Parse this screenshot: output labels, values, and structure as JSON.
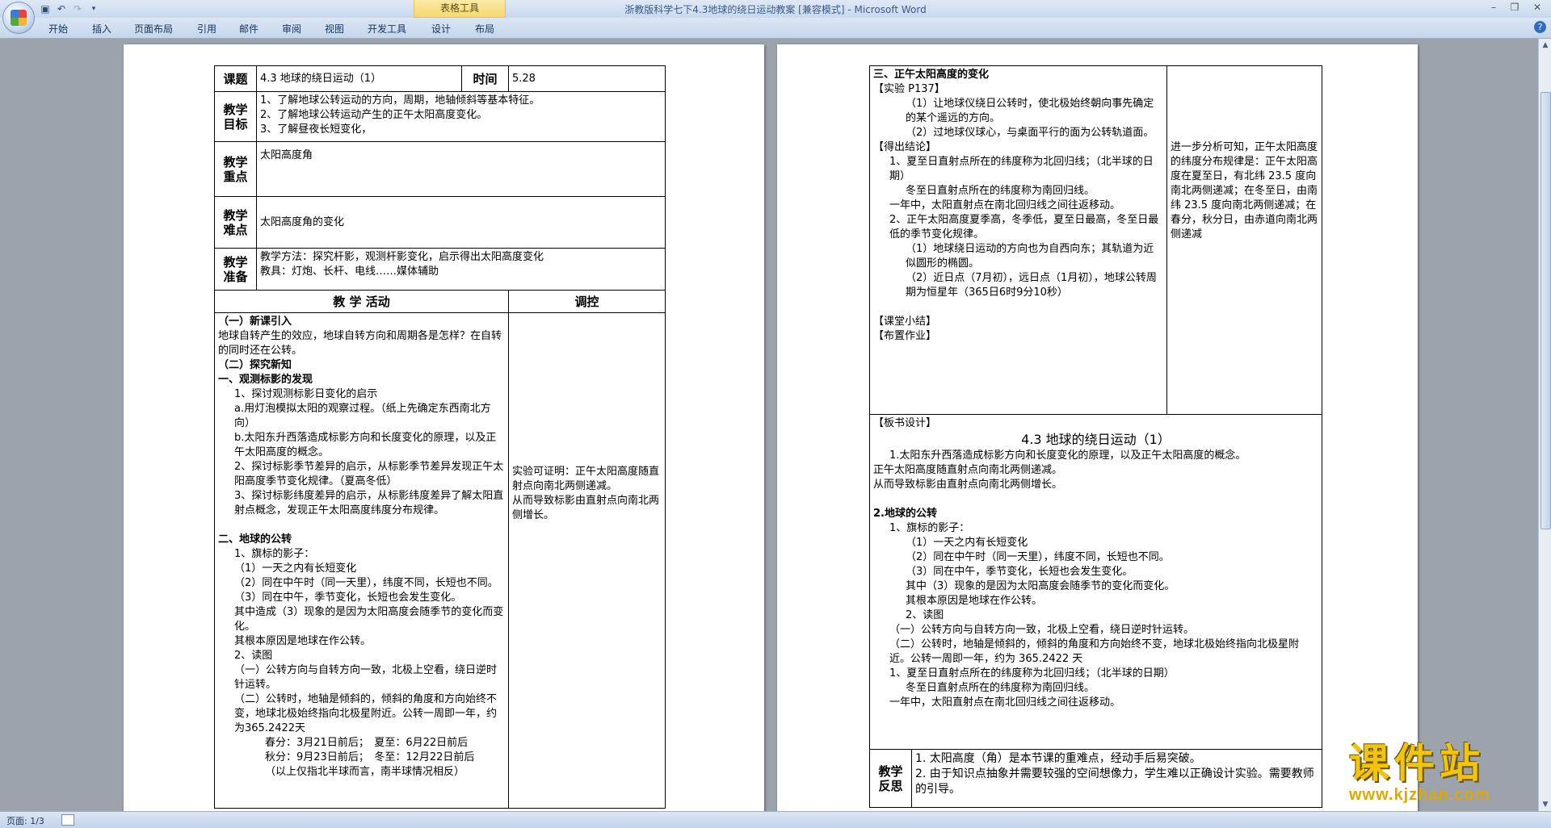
{
  "window": {
    "title": "浙教版科学七下4.3地球的绕日运动教案 [兼容模式] - Microsoft Word",
    "context_tab": "表格工具",
    "controls": [
      "–",
      "❐",
      "✕"
    ]
  },
  "quick_access": {
    "icons": [
      "save-icon",
      "undo-icon",
      "redo-icon",
      "customize-icon"
    ]
  },
  "ribbon": {
    "tabs": [
      "开始",
      "插入",
      "页面布局",
      "引用",
      "邮件",
      "审阅",
      "视图",
      "开发工具",
      "设计",
      "布局"
    ],
    "help": "?"
  },
  "page1": {
    "topic_label": "课题",
    "topic_value": "4.3 地球的绕日运动（1）",
    "time_label": "时间",
    "time_value": "5.28",
    "goal_label": "教学目标",
    "goals": [
      "1、了解地球公转运动的方向，周期，地轴倾斜等基本特征。",
      "2、了解地球公转运动产生的正午太阳高度变化。",
      "3、了解昼夜长短变化，"
    ],
    "focus_label": "教学重点",
    "focus_value": "太阳高度角",
    "difficulty_label": "教学难点",
    "difficulty_value": "太阳高度角的变化",
    "prep_label": "教学准备",
    "prep_lines": [
      "教学方法：探究杆影，观测杆影变化，启示得出太阳高度变化",
      "教具：灯炮、长杆、电线……媒体辅助"
    ],
    "activity_header": "教 学 活动",
    "control_header": "调控",
    "activity_lines": [
      {
        "t": "（一）新课引入",
        "c": "bold"
      },
      {
        "t": "地球自转产生的效应，地球自转方向和周期各是怎样？在自转的同时还在公转。",
        "c": ""
      },
      {
        "t": "（二）探究新知",
        "c": "bold"
      },
      {
        "t": "一、观测标影的发现",
        "c": "bold"
      },
      {
        "t": "1、探讨观测标影日变化的启示",
        "c": "ind1"
      },
      {
        "t": "a.用灯泡模拟太阳的观察过程。（纸上先确定东西南北方向）",
        "c": "ind1"
      },
      {
        "t": "b.太阳东升西落造成标影方向和长度变化的原理，以及正午太阳高度的概念。",
        "c": "ind1"
      },
      {
        "t": "2、探讨标影季节差异的启示，从标影季节差异发现正午太阳高度季节变化规律。（夏高冬低）",
        "c": "ind1"
      },
      {
        "t": "3、探讨标影纬度差异的启示，从标影纬度差异了解太阳直射点概念，发现正午太阳高度纬度分布规律。",
        "c": "ind1"
      },
      {
        "t": "",
        "c": ""
      },
      {
        "t": "二、地球的公转",
        "c": "bold"
      },
      {
        "t": "1、旗标的影子：",
        "c": "ind1"
      },
      {
        "t": "（1）一天之内有长短变化",
        "c": "ind1"
      },
      {
        "t": "（2）同在中午时（同一天里），纬度不同，长短也不同。",
        "c": "ind1"
      },
      {
        "t": "（3）同在中午，季节变化，长短也会发生变化。",
        "c": "ind1"
      },
      {
        "t": "其中造成（3）现象的是因为太阳高度会随季节的变化而变化。",
        "c": "ind1"
      },
      {
        "t": "其根本原因是地球在作公转。",
        "c": "ind1"
      },
      {
        "t": "2、读图",
        "c": "ind1"
      },
      {
        "t": "（一）公转方向与自转方向一致，北极上空看，绕日逆时针运转。",
        "c": "ind1"
      },
      {
        "t": "（二）公转时，地轴是倾斜的，倾斜的角度和方向始终不变，地球北极始终指向北极星附近。公转一周即一年，约为365.2422天",
        "c": "ind1"
      },
      {
        "t": "春分：3月21日前后；　夏至：6月22日前后",
        "c": "ind3"
      },
      {
        "t": "秋分：9月23日前后；　冬至：12月22日前后",
        "c": "ind3"
      },
      {
        "t": "（以上仅指北半球而言，南半球情况相反）",
        "c": "ind3"
      }
    ],
    "control_note_1": "实验可证明：正午太阳高度随直射点向南北两侧递减。",
    "control_note_2": "从而导致标影由直射点向南北两侧增长。"
  },
  "page2": {
    "left_lines": [
      {
        "t": "三、正午太阳高度的变化",
        "c": "bold"
      },
      {
        "t": "【实验 P137】",
        "c": ""
      },
      {
        "t": "（1）让地球仪绕日公转时，使北极始终朝向事先确定的某个遥远的方向。",
        "c": "ind2"
      },
      {
        "t": "（2）过地球仪球心，与桌面平行的面为公转轨道面。",
        "c": "ind2"
      },
      {
        "t": "【得出结论】",
        "c": ""
      },
      {
        "t": "1、夏至日直射点所在的纬度称为北回归线；（北半球的日期）",
        "c": "ind1"
      },
      {
        "t": "冬至日直射点所在的纬度称为南回归线。",
        "c": "ind2"
      },
      {
        "t": "一年中，太阳直射点在南北回归线之间往返移动。",
        "c": "ind1"
      },
      {
        "t": "2、正午太阳高度夏季高，冬季低，夏至日最高，冬至日最低的季节变化规律。",
        "c": "ind1"
      },
      {
        "t": "（1）地球绕日运动的方向也为自西向东；其轨道为近似圆形的椭圆。",
        "c": "ind2"
      },
      {
        "t": "（2）近日点（7月初），远日点（1月初），地球公转周期为恒星年（365日6时9分10秒）",
        "c": "ind2"
      },
      {
        "t": "",
        "c": ""
      },
      {
        "t": "【课堂小结】",
        "c": ""
      },
      {
        "t": "【布置作业】",
        "c": ""
      }
    ],
    "right_note": "进一步分析可知，正午太阳高度的纬度分布规律是：正午太阳高度在夏至日，有北纬 23.5 度向南北两侧递减；在冬至日，由南纬 23.5 度向南北两侧递减；在春分，秋分日，由赤道向南北两侧递减",
    "board_label": "【板书设计】",
    "board_title": "4.3 地球的绕日运动（1）",
    "board_lines": [
      {
        "t": "1.太阳东升西落造成标影方向和长度变化的原理，以及正午太阳高度的概念。",
        "c": "ind1"
      },
      {
        "t": "正午太阳高度随直射点向南北两侧递减。",
        "c": ""
      },
      {
        "t": "从而导致标影由直射点向南北两侧增长。",
        "c": ""
      },
      {
        "t": "",
        "c": ""
      },
      {
        "t": "2.地球的公转",
        "c": "bold"
      },
      {
        "t": "1、旗标的影子：",
        "c": "ind1"
      },
      {
        "t": "（1）一天之内有长短变化",
        "c": "ind2"
      },
      {
        "t": "（2）同在中午时（同一天里），纬度不同，长短也不同。",
        "c": "ind2"
      },
      {
        "t": "（3）同在中午，季节变化，长短也会发生变化。",
        "c": "ind2"
      },
      {
        "t": "其中（3）现象的是因为太阳高度会随季节的变化而变化。",
        "c": "ind2"
      },
      {
        "t": "其根本原因是地球在作公转。",
        "c": "ind2"
      },
      {
        "t": "2、读图",
        "c": "ind2"
      },
      {
        "t": "（一）公转方向与自转方向一致，北极上空看，绕日逆时针运转。",
        "c": "ind1"
      },
      {
        "t": "（二）公转时，地轴是倾斜的，倾斜的角度和方向始终不变，地球北极始终指向北极星附近。公转一周即一年，约为 365.2422 天",
        "c": "ind1"
      },
      {
        "t": "1、夏至日直射点所在的纬度称为北回归线；（北半球的日期）",
        "c": "ind1"
      },
      {
        "t": "冬至日直射点所在的纬度称为南回归线。",
        "c": "ind2"
      },
      {
        "t": "一年中，太阳直射点在南北回归线之间往返移动。",
        "c": "ind1"
      }
    ],
    "reflection_label": "教学反思",
    "reflection_lines": [
      "1. 太阳高度（角）是本节课的重难点，经动手后易突破。",
      "2. 由于知识点抽象并需要较强的空间想像力，学生难以正确设计实验。需要教师的引导。"
    ]
  },
  "status": {
    "page_indicator": "页面: 1/3"
  },
  "watermark": {
    "title": "课件站",
    "url": "www.kjzhan.com"
  },
  "scrollbar": {
    "up": "▲",
    "down": "▼"
  }
}
